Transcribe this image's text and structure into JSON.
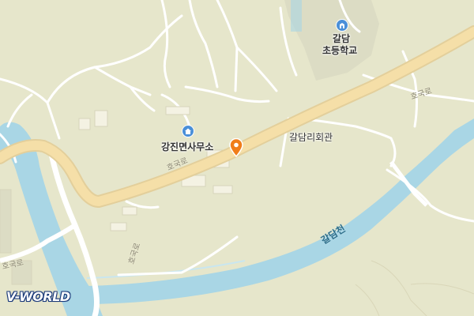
{
  "map": {
    "logo": "V-WORLD",
    "pois": [
      {
        "id": "school",
        "name_line1": "갈담",
        "name_line2": "초등학교",
        "icon": "school-icon"
      },
      {
        "id": "office",
        "name": "강진면사무소",
        "icon": "government-office-icon"
      },
      {
        "id": "hall",
        "name": "갈담리회관"
      }
    ],
    "roads": [
      {
        "id": "road-main",
        "name": "호국로"
      },
      {
        "id": "road-right",
        "name": "호국로"
      },
      {
        "id": "road-vertical",
        "name": "호국로"
      },
      {
        "id": "road-left",
        "name": "호국로"
      }
    ],
    "river": {
      "name": "갈담천"
    },
    "marker": {
      "icon": "location-pin-icon",
      "color": "#f07d1a"
    },
    "colors": {
      "land": "#e6e6cb",
      "water": "#a9d6e5",
      "main_road": "#f5dfa8",
      "minor_road": "#ffffff"
    }
  }
}
